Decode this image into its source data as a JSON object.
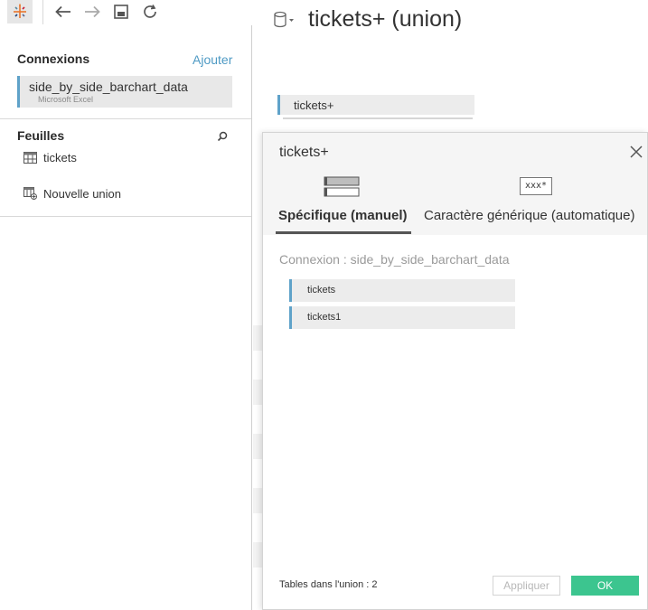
{
  "toolbar": {
    "icons": [
      "tableau-logo-icon",
      "undo-icon",
      "redo-icon",
      "save-icon",
      "refresh-icon"
    ]
  },
  "sidebar": {
    "connections_heading": "Connexions",
    "add_link": "Ajouter",
    "connection": {
      "name": "side_by_side_barchart_data",
      "type": "Microsoft Excel"
    },
    "sheets_heading": "Feuilles",
    "sheets": [
      {
        "label": "tickets",
        "icon": "table-icon"
      },
      {
        "label": "Nouvelle union",
        "icon": "new-union-icon"
      }
    ]
  },
  "canvas": {
    "title": "tickets+ (union)",
    "table_pill": "tickets+"
  },
  "dialog": {
    "title": "tickets+",
    "tabs": [
      {
        "label": "Spécifique (manuel)",
        "active": true
      },
      {
        "label": "Caractère générique (automatique)",
        "active": false,
        "icon_text": "xxx*"
      }
    ],
    "connection_line": "Connexion : side_by_side_barchart_data",
    "tables": [
      "tickets",
      "tickets1"
    ],
    "count_label": "Tables dans l'union : 2",
    "apply_label": "Appliquer",
    "ok_label": "OK"
  },
  "colors": {
    "accent_blue": "#5fa2c9",
    "link_blue": "#4e9ac4",
    "ok_green": "#3cc58f"
  }
}
